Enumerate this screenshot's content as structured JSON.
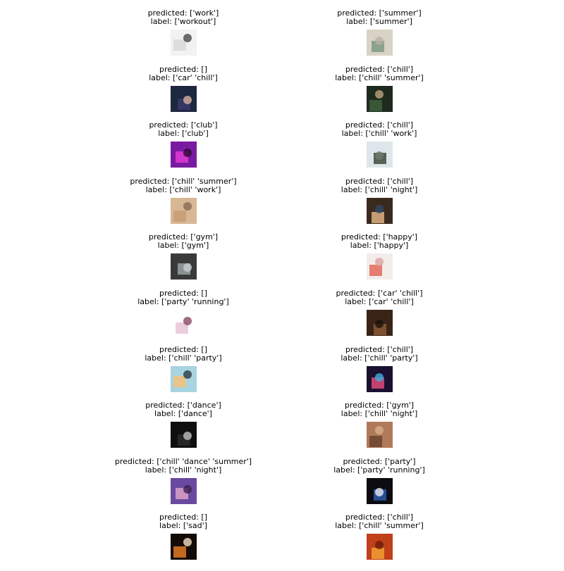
{
  "chart_data": {
    "type": "image-grid",
    "columns": 2,
    "rows": 10,
    "items": [
      {
        "predicted": "predicted: ['work']",
        "label": "label: ['workout']",
        "thumb": "seraph-text-poster",
        "colors": [
          "#f2f2f2",
          "#d9d9d9",
          "#4a4a4a"
        ]
      },
      {
        "predicted": "predicted: ['summer']",
        "label": "label: ['summer']",
        "thumb": "beige-scene-green-object",
        "colors": [
          "#d9d2c6",
          "#7f9a7f",
          "#b9b1a4"
        ]
      },
      {
        "predicted": "predicted: []",
        "label": "label: ['car' 'chill']",
        "thumb": "person-in-car-dark",
        "colors": [
          "#1e2740",
          "#3a3a6a",
          "#d7b29a"
        ]
      },
      {
        "predicted": "predicted: ['chill']",
        "label": "label: ['chill' 'summer']",
        "thumb": "dark-green-room",
        "colors": [
          "#1f2a1f",
          "#3f5f3a",
          "#bca27a"
        ]
      },
      {
        "predicted": "predicted: ['club']",
        "label": "label: ['club']",
        "thumb": "pink-club-lights",
        "colors": [
          "#7a1aa0",
          "#e23ad6",
          "#2a0a30"
        ]
      },
      {
        "predicted": "predicted: ['chill']",
        "label": "label: ['chill' 'work']",
        "thumb": "window-desk",
        "colors": [
          "#dde6ea",
          "#3d4a3a",
          "#6f7a6a"
        ]
      },
      {
        "predicted": "predicted: ['chill' 'summer']",
        "label": "label: ['chill' 'work']",
        "thumb": "beige-album-cover",
        "colors": [
          "#d8b795",
          "#c79d77",
          "#8a6a52"
        ]
      },
      {
        "predicted": "predicted: ['chill']",
        "label": "label: ['chill' 'night']",
        "thumb": "person-selfie",
        "colors": [
          "#3a2a1e",
          "#e0b080",
          "#2d4a6a"
        ]
      },
      {
        "predicted": "predicted: ['gym']",
        "label": "label: ['gym']",
        "thumb": "gym-interior",
        "colors": [
          "#3a3a3a",
          "#9aa0a3",
          "#c9cfd1"
        ]
      },
      {
        "predicted": "predicted: ['happy']",
        "label": "label: ['happy']",
        "thumb": "happy-new-year-2022",
        "colors": [
          "#f3ecea",
          "#e26a5a",
          "#d9a5a0"
        ]
      },
      {
        "predicted": "predicted: []",
        "label": "label: ['party' 'running']",
        "thumb": "sneakers",
        "colors": [
          "#ffffff",
          "#e7c6d6",
          "#8a4a66"
        ]
      },
      {
        "predicted": "predicted: ['car' 'chill']",
        "label": "label: ['car' 'chill']",
        "thumb": "car-dashboard",
        "colors": [
          "#3a2418",
          "#8a5a34",
          "#1a120c"
        ]
      },
      {
        "predicted": "predicted: []",
        "label": "label: ['chill' 'party']",
        "thumb": "deep-house-beach-chill-cover",
        "colors": [
          "#a8d3e0",
          "#f2c27a",
          "#2a3a44"
        ]
      },
      {
        "predicted": "predicted: ['chill']",
        "label": "label: ['chill' 'party']",
        "thumb": "neon-portrait",
        "colors": [
          "#1a1030",
          "#e04a7a",
          "#3ab0e0"
        ]
      },
      {
        "predicted": "predicted: ['dance']",
        "label": "label: ['dance']",
        "thumb": "dancer-dark",
        "colors": [
          "#0f0f10",
          "#2a2a2e",
          "#bfbfbf"
        ]
      },
      {
        "predicted": "predicted: ['gym']",
        "label": "label: ['chill' 'night']",
        "thumb": "warm-room",
        "colors": [
          "#b07a5a",
          "#6a4432",
          "#d6b08a"
        ]
      },
      {
        "predicted": "predicted: ['chill' 'dance' 'summer']",
        "label": "label: ['chill' 'night']",
        "thumb": "purple-hair-portrait",
        "colors": [
          "#6a4aa0",
          "#d9a0c8",
          "#3a2050"
        ]
      },
      {
        "predicted": "predicted: ['party']",
        "label": "label: ['party' 'running']",
        "thumb": "blue-sign-dark",
        "colors": [
          "#0c0c10",
          "#2a5aa8",
          "#e8e8f0"
        ]
      },
      {
        "predicted": "predicted: []",
        "label": "label: ['sad']",
        "thumb": "text-over-fire",
        "colors": [
          "#140a06",
          "#e07a20",
          "#f0e0c0"
        ]
      },
      {
        "predicted": "predicted: ['chill']",
        "label": "label: ['chill' 'summer']",
        "thumb": "orange-text-poster",
        "colors": [
          "#c0401a",
          "#f0a030",
          "#6a1a0a"
        ]
      }
    ]
  }
}
